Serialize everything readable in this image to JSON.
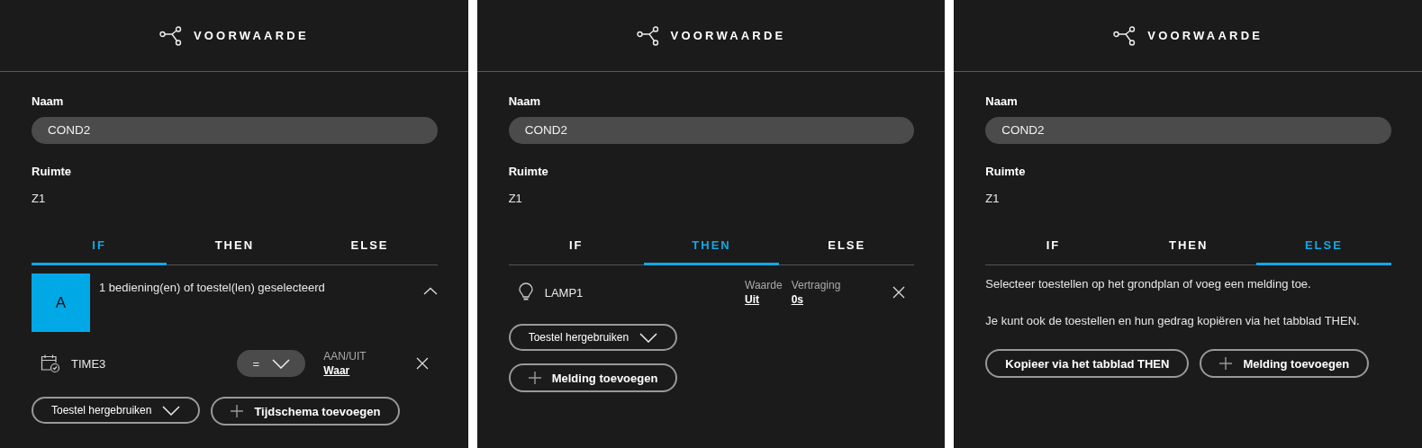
{
  "panels": [
    {
      "header": {
        "title": "VOORWAARDE"
      },
      "name_label": "Naam",
      "name_value": "COND2",
      "room_label": "Ruimte",
      "room_value": "Z1",
      "tabs": [
        {
          "label": "IF",
          "selected": true
        },
        {
          "label": "THEN",
          "selected": false
        },
        {
          "label": "ELSE",
          "selected": false
        }
      ],
      "content": [
        {
          "kind": "group",
          "badge": "A",
          "text": "1 bediening(en) of toestel(len) geselecteerd",
          "expanded": true
        },
        {
          "kind": "condition",
          "name": "TIME3",
          "operator": "=",
          "fields": [
            {
              "label": "AAN/UIT",
              "value": "Waar"
            }
          ]
        },
        {
          "kind": "actions",
          "buttons": [
            {
              "kind": "dropdown",
              "label": "Toestel hergebruiken"
            },
            {
              "kind": "add",
              "label": "Tijdschema toevoegen"
            }
          ]
        }
      ]
    },
    {
      "header": {
        "title": "VOORWAARDE"
      },
      "name_label": "Naam",
      "name_value": "COND2",
      "room_label": "Ruimte",
      "room_value": "Z1",
      "tabs": [
        {
          "label": "IF",
          "selected": false
        },
        {
          "label": "THEN",
          "selected": true
        },
        {
          "label": "ELSE",
          "selected": false
        }
      ],
      "content": [
        {
          "kind": "device",
          "name": "LAMP1",
          "fields": [
            {
              "label": "Waarde",
              "value": "Uit"
            },
            {
              "label": "Vertraging",
              "value": "0s"
            }
          ]
        },
        {
          "kind": "actions",
          "buttons": [
            {
              "kind": "dropdown",
              "label": "Toestel hergebruiken"
            }
          ]
        },
        {
          "kind": "actions",
          "buttons": [
            {
              "kind": "add",
              "label": "Melding toevoegen"
            }
          ]
        }
      ]
    },
    {
      "header": {
        "title": "VOORWAARDE"
      },
      "name_label": "Naam",
      "name_value": "COND2",
      "room_label": "Ruimte",
      "room_value": "Z1",
      "tabs": [
        {
          "label": "IF",
          "selected": false
        },
        {
          "label": "THEN",
          "selected": false
        },
        {
          "label": "ELSE",
          "selected": true
        }
      ],
      "content": [
        {
          "kind": "paragraph",
          "text": "Selecteer toestellen op het grondplan of voeg een melding toe."
        },
        {
          "kind": "paragraph",
          "text": "Je kunt ook de toestellen en hun gedrag kopiëren via het tabblad THEN."
        },
        {
          "kind": "actions",
          "buttons": [
            {
              "kind": "plain",
              "label": "Kopieer via het tabblad THEN"
            },
            {
              "kind": "add",
              "label": "Melding toevoegen"
            }
          ]
        }
      ]
    }
  ]
}
